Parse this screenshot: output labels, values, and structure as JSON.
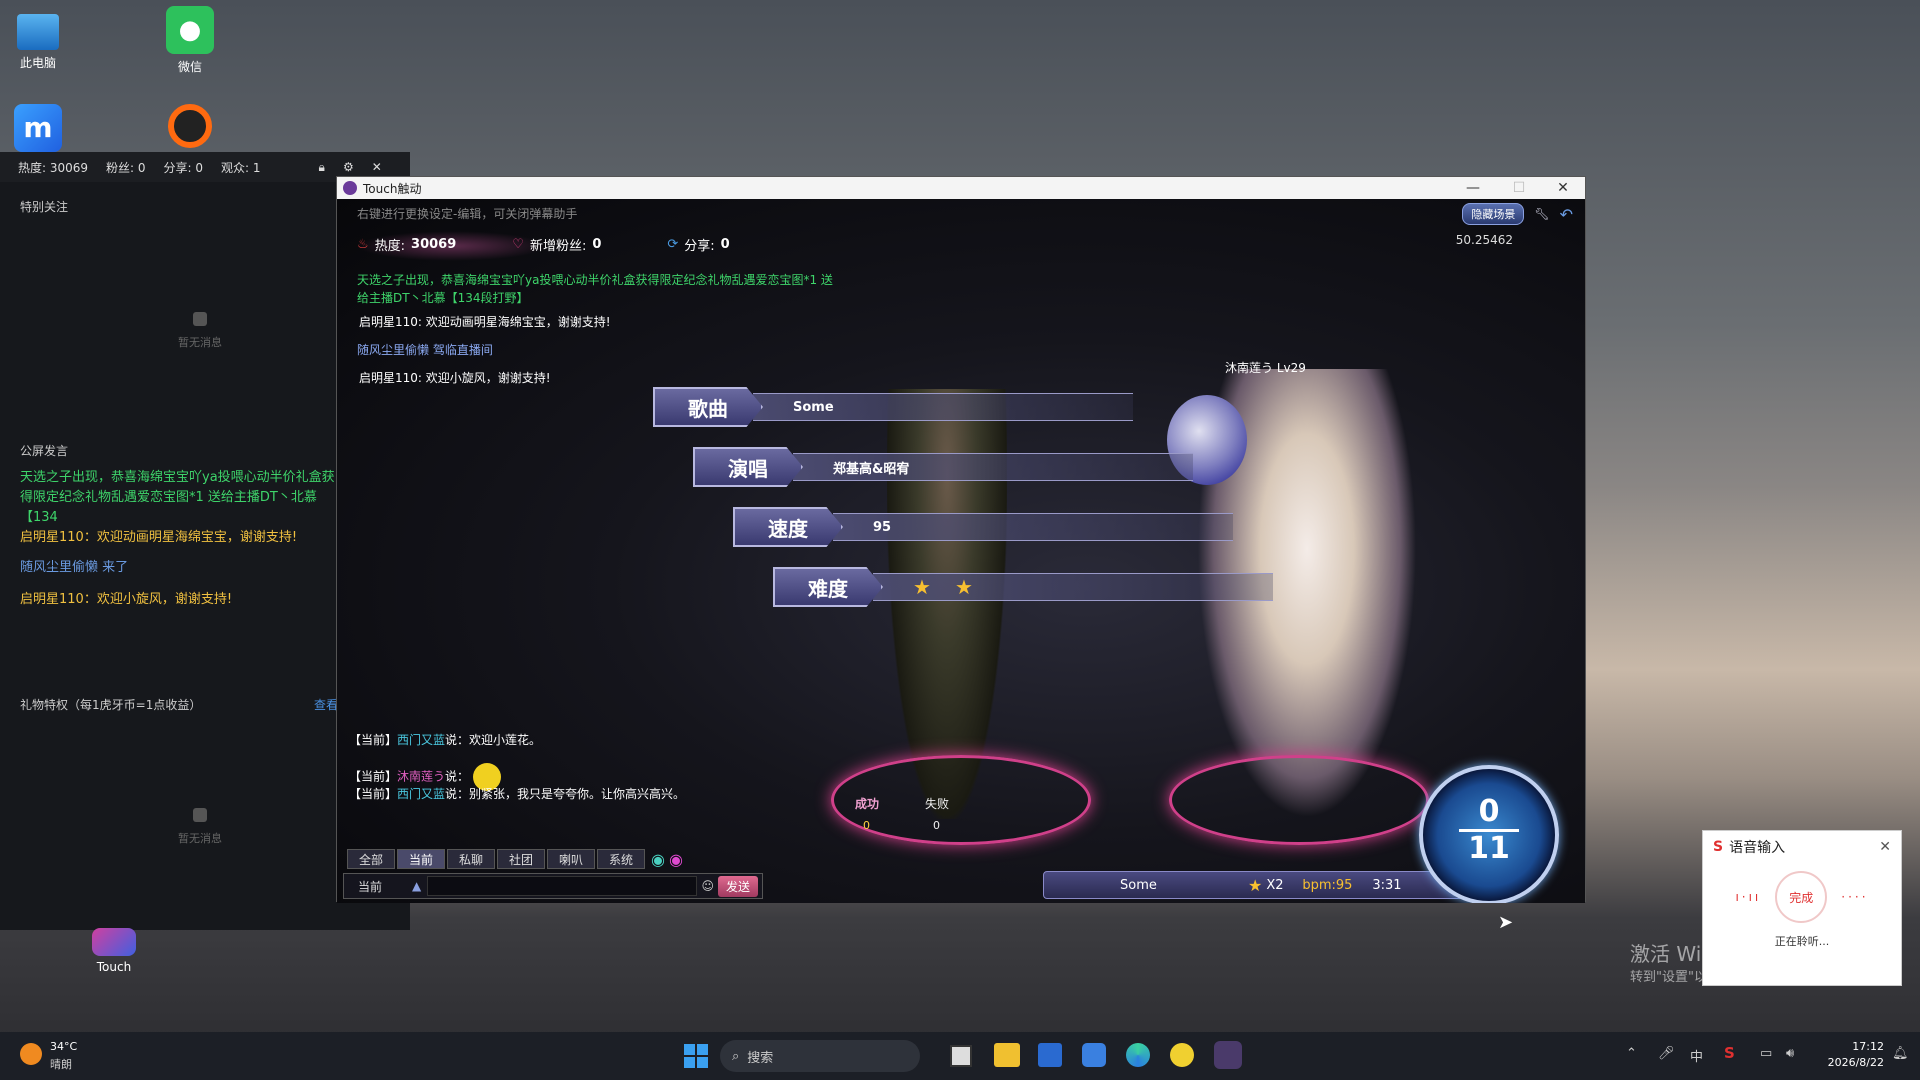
{
  "desktop": {
    "icons": [
      {
        "label": "此电脑",
        "name": "this-pc-icon"
      },
      {
        "label": "微信",
        "name": "wechat-icon"
      },
      {
        "label": "",
        "name": "meitu-icon"
      },
      {
        "label": "",
        "name": "record-icon"
      },
      {
        "label": "Touch",
        "name": "touch-game-icon"
      }
    ]
  },
  "live_panel": {
    "stats": {
      "heat": "热度: 30069",
      "fans": "粉丝: 0",
      "shares": "分享: 0",
      "viewers": "观众: 1"
    },
    "special_follow": "特别关注",
    "empty1": "暂无消息",
    "public_chat": "公屏发言",
    "messages": [
      "天选之子出现，恭喜海绵宝宝吖ya投喂心动半价礼盒获得限定纪念礼物乱遇爱恋宝图*1 送给主播DT丶北慕【134",
      "启明星110：欢迎动画明星海绵宝宝，谢谢支持!",
      "随风尘里偷懒 来了",
      "启明星110：欢迎小旋风，谢谢支持!"
    ],
    "gift_title": "礼物特权（每1虎牙币=1点收益）",
    "gift_link": "查看",
    "empty2": "暂无消息"
  },
  "game": {
    "title": "Touch触动",
    "tip": "右键进行更换设定-编辑，可关闭弹幕助手",
    "hide_scene": "隐藏场景",
    "coord": "50.25462",
    "stats": {
      "heat_label": "热度:",
      "heat": "30069",
      "fans_label": "新增粉丝:",
      "fans": "0",
      "share_label": "分享:",
      "share": "0"
    },
    "chat": [
      "天选之子出现，恭喜海绵宝宝吖ya投喂心动半价礼盒获得限定纪念礼物乱遇爱恋宝图*1 送给主播DT丶北慕【134段打野】",
      "启明星110: 欢迎动画明星海绵宝宝，谢谢支持!",
      "随风尘里偷懒 驾临直播间",
      "启明星110: 欢迎小旋风，谢谢支持!"
    ],
    "player_name": "沐南莲う Lv29",
    "song_info": {
      "song_label": "歌曲",
      "song": "Some",
      "singer_label": "演唱",
      "singer": "郑基高&昭宥",
      "speed_label": "速度",
      "speed": "95",
      "diff_label": "难度",
      "stars": 2
    },
    "chat_bottom": [
      {
        "prefix": "【当前】",
        "name": "西门又蓝",
        "text": "说：欢迎小莲花。"
      },
      {
        "prefix": "【当前】",
        "name": "沐南莲う",
        "text": "说："
      },
      {
        "prefix": "【当前】",
        "name": "西门又蓝",
        "text": "说：别紧张，我只是夸夸你。让你高兴高兴。"
      }
    ],
    "tabs": [
      "全部",
      "当前",
      "私聊",
      "社团",
      "喇叭",
      "系统"
    ],
    "channel": "当前",
    "send": "发送",
    "success_label": "成功",
    "success": "0",
    "fail_label": "失败",
    "fail": "0",
    "bottom_song": "Some",
    "multiplier": "X2",
    "bpm": "bpm:95",
    "duration": "3:31",
    "counter_top": "0",
    "counter_bottom": "11"
  },
  "watermark": {
    "line1": "激活 Windows",
    "line2": "转到\"设置\"以激活 Windows。"
  },
  "voice": {
    "title": "语音输入",
    "done": "完成",
    "listening": "正在聆听..."
  },
  "taskbar": {
    "weather_temp": "34°C",
    "weather_desc": "晴朗",
    "search": "搜索",
    "time": "17:12",
    "date": "2026/8/22"
  }
}
